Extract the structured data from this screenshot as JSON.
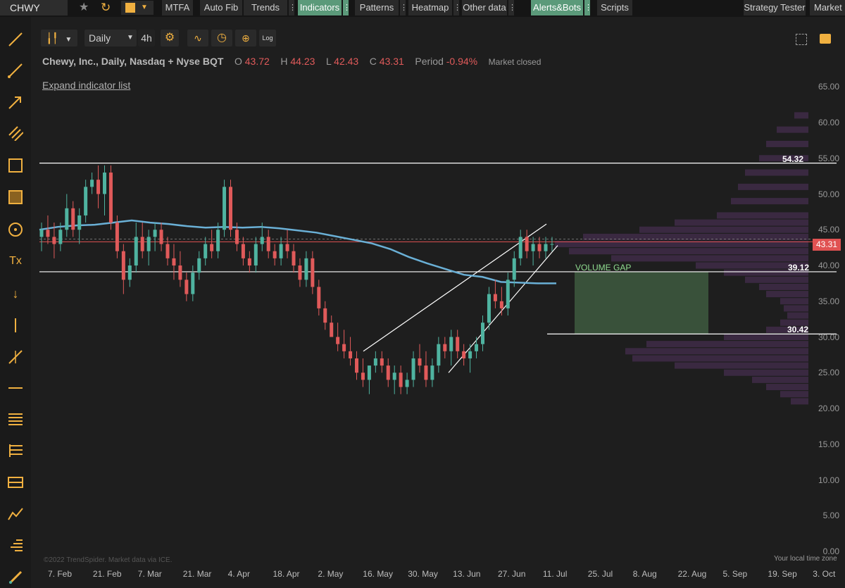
{
  "symbol": "CHWY",
  "toolbar": {
    "mtfa": "MTFA",
    "auto_fib": "Auto Fib",
    "trends": "Trends",
    "indicators": "Indicators",
    "patterns": "Patterns",
    "heatmap": "Heatmap",
    "other_data": "Other data",
    "alerts_bots": "Alerts&Bots",
    "scripts": "Scripts",
    "strategy_tester": "Strategy Tester",
    "market": "Market S",
    "dots": "⋮"
  },
  "chart_controls": {
    "timeframe": "Daily",
    "alt_timeframe": "4h",
    "log_label": "Log"
  },
  "legend": {
    "title": "Chewy, Inc., Daily, Nasdaq + Nyse BQT",
    "open_k": "O",
    "open_v": "43.72",
    "high_k": "H",
    "high_v": "44.23",
    "low_k": "L",
    "low_v": "42.43",
    "close_k": "C",
    "close_v": "43.31",
    "period_k": "Period",
    "period_v": "-0.94%",
    "status": "Market closed"
  },
  "expand_link": "Expand indicator list",
  "levels": {
    "upper": "54.32",
    "mid": "39.12",
    "lower": "30.42",
    "last_price": "43.31",
    "volume_gap": "VOLUME GAP"
  },
  "footer": {
    "credit": "©2022 TrendSpider. Market data via ICE.",
    "timezone": "Your local time zone"
  },
  "colors": {
    "up": "#4fb3a0",
    "down": "#e05a5a",
    "ma": "#6ab0d6",
    "volume_profile": "#3d2a45",
    "gap_fill": "#3e5a40",
    "accent_active": "#5b9a7a",
    "tool_icons": "#f0b040"
  },
  "chart_data": {
    "type": "candlestick",
    "title": "Chewy, Inc., Daily, Nasdaq + Nyse BQT",
    "y_ticks": [
      "65.00",
      "60.00",
      "55.00",
      "50.00",
      "45.00",
      "40.00",
      "35.00",
      "30.00",
      "25.00",
      "20.00",
      "15.00",
      "10.00",
      "5.00",
      "0.00"
    ],
    "x_ticks": [
      "7. Feb",
      "21. Feb",
      "7. Mar",
      "21. Mar",
      "4. Apr",
      "18. Apr",
      "2. May",
      "16. May",
      "30. May",
      "13. Jun",
      "27. Jun",
      "11. Jul",
      "25. Jul",
      "8. Aug",
      "22. Aug",
      "5. Sep",
      "19. Sep",
      "3. Oct"
    ],
    "ylim": [
      0,
      65
    ],
    "horizontal_levels": [
      54.32,
      39.12,
      30.42,
      43.31
    ],
    "volume_gap_range": [
      30.42,
      39.12
    ],
    "candles": [
      [
        44,
        46,
        42,
        45
      ],
      [
        45,
        47,
        43,
        44
      ],
      [
        44,
        46,
        41,
        43
      ],
      [
        43,
        46,
        42,
        45
      ],
      [
        45,
        50,
        44,
        48
      ],
      [
        48,
        49,
        44,
        45
      ],
      [
        45,
        48,
        43,
        47
      ],
      [
        47,
        52,
        46,
        51
      ],
      [
        51,
        53,
        50,
        52
      ],
      [
        52,
        54,
        48,
        50
      ],
      [
        50,
        54,
        47,
        53
      ],
      [
        53,
        54,
        45,
        46
      ],
      [
        46,
        47,
        41,
        42
      ],
      [
        42,
        43,
        36,
        38
      ],
      [
        38,
        41,
        37,
        40
      ],
      [
        40,
        46,
        39,
        44
      ],
      [
        44,
        46,
        41,
        42
      ],
      [
        42,
        45,
        40,
        44
      ],
      [
        44,
        46,
        42,
        45
      ],
      [
        45,
        46,
        42,
        43
      ],
      [
        43,
        44,
        40,
        41
      ],
      [
        41,
        43,
        38,
        40
      ],
      [
        40,
        42,
        37,
        38
      ],
      [
        38,
        39,
        35,
        36
      ],
      [
        36,
        40,
        35,
        39
      ],
      [
        39,
        42,
        38,
        41
      ],
      [
        41,
        44,
        40,
        43
      ],
      [
        43,
        45,
        41,
        42
      ],
      [
        42,
        46,
        41,
        45
      ],
      [
        45,
        52,
        44,
        51
      ],
      [
        51,
        52,
        44,
        45
      ],
      [
        45,
        46,
        42,
        43
      ],
      [
        43,
        44,
        40,
        41
      ],
      [
        41,
        42,
        39,
        40
      ],
      [
        40,
        44,
        39,
        43
      ],
      [
        43,
        46,
        42,
        44
      ],
      [
        44,
        45,
        41,
        42
      ],
      [
        42,
        43,
        40,
        41
      ],
      [
        41,
        44,
        40,
        43
      ],
      [
        43,
        45,
        41,
        42
      ],
      [
        42,
        43,
        39,
        40
      ],
      [
        40,
        41,
        37,
        38
      ],
      [
        38,
        42,
        37,
        41
      ],
      [
        41,
        42,
        36,
        37
      ],
      [
        37,
        38,
        33,
        34
      ],
      [
        34,
        35,
        31,
        32
      ],
      [
        32,
        33,
        30,
        30
      ],
      [
        30,
        32,
        28,
        29
      ],
      [
        29,
        31,
        27,
        28
      ],
      [
        28,
        30,
        26,
        27
      ],
      [
        27,
        28,
        24,
        25
      ],
      [
        25,
        27,
        23,
        24
      ],
      [
        24,
        26,
        22,
        26
      ],
      [
        26,
        28,
        25,
        27
      ],
      [
        27,
        28,
        25,
        26
      ],
      [
        26,
        27,
        23,
        24
      ],
      [
        24,
        26,
        22,
        25
      ],
      [
        25,
        26,
        22,
        23
      ],
      [
        23,
        25,
        22,
        24
      ],
      [
        24,
        28,
        23,
        27
      ],
      [
        27,
        29,
        25,
        26
      ],
      [
        26,
        28,
        23,
        24
      ],
      [
        24,
        27,
        23,
        26
      ],
      [
        26,
        30,
        25,
        29
      ],
      [
        29,
        30,
        27,
        28
      ],
      [
        28,
        31,
        26,
        30
      ],
      [
        30,
        31,
        27,
        28
      ],
      [
        28,
        29,
        26,
        27
      ],
      [
        27,
        29,
        25,
        28
      ],
      [
        28,
        30,
        27,
        29
      ],
      [
        29,
        33,
        28,
        32
      ],
      [
        32,
        37,
        31,
        36
      ],
      [
        36,
        38,
        34,
        35
      ],
      [
        35,
        37,
        33,
        34
      ],
      [
        34,
        39,
        33,
        38
      ],
      [
        38,
        42,
        37,
        41
      ],
      [
        41,
        45,
        40,
        44
      ],
      [
        44,
        45,
        41,
        42
      ],
      [
        42,
        44,
        40,
        43
      ],
      [
        43,
        44,
        41,
        42
      ],
      [
        42,
        44,
        41,
        43
      ],
      [
        43,
        44,
        42,
        43
      ]
    ],
    "ma_series": [
      45,
      45.4,
      45.6,
      45.7,
      46,
      46.3,
      46,
      45.8,
      45.5,
      45.3,
      45.4,
      45.3,
      45.4,
      45.2,
      44.9,
      44.6,
      44.1,
      43.6,
      43.1,
      42.3,
      41.2,
      40.3,
      39.5,
      38.7,
      38.4,
      37.7,
      37.6,
      37.5,
      37.5
    ],
    "channel_upper": [
      [
        28.0,
        45.8
      ],
      [
        16.5,
        28.0
      ]
    ],
    "channel_lower": [
      [
        25.0,
        42.8
      ]
    ]
  }
}
